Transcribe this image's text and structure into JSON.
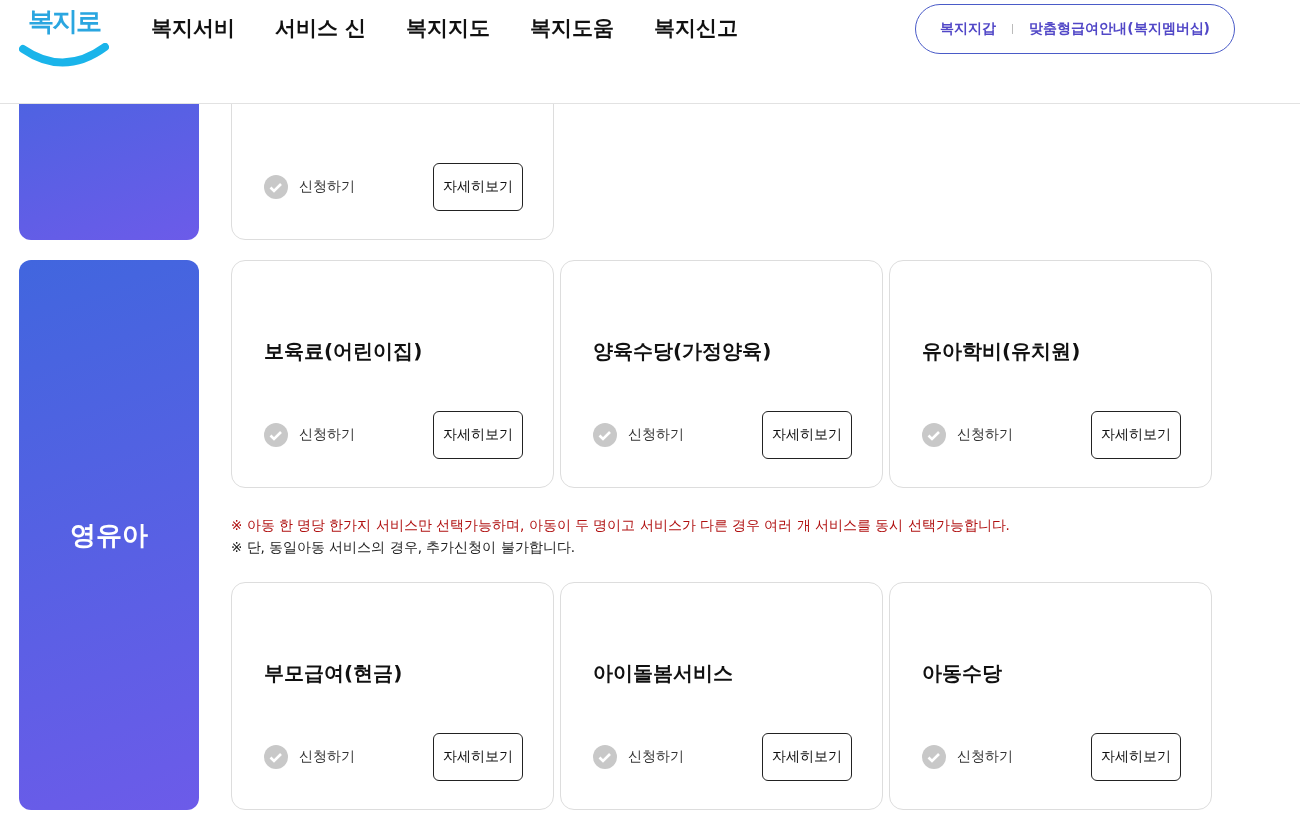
{
  "header": {
    "logo": "복지로",
    "nav": [
      "복지서비",
      "서비스 신",
      "복지지도",
      "복지도움",
      "복지신고"
    ],
    "quick_links": [
      "복지지갑",
      "맞춤형급여안내(복지멤버십)"
    ]
  },
  "partial_section": {
    "cards": [
      {
        "apply_label": "신청하기",
        "checked": false,
        "detail_button": "자세히보기"
      }
    ]
  },
  "section": {
    "category": "영유아",
    "card_rows": [
      [
        {
          "title": "보육료(어린이집)",
          "apply_label": "신청하기",
          "checked": false,
          "detail_button": "자세히보기"
        },
        {
          "title": "양육수당(가정양육)",
          "apply_label": "신청하기",
          "checked": false,
          "detail_button": "자세히보기"
        },
        {
          "title": "유아학비(유치원)",
          "apply_label": "신청하기",
          "checked": false,
          "detail_button": "자세히보기"
        }
      ],
      [
        {
          "title": "부모급여(현금)",
          "apply_label": "신청하기",
          "checked": false,
          "detail_button": "자세히보기"
        },
        {
          "title": "아이돌봄서비스",
          "apply_label": "신청하기",
          "checked": false,
          "detail_button": "자세히보기"
        },
        {
          "title": "아동수당",
          "apply_label": "신청하기",
          "checked": false,
          "detail_button": "자세히보기"
        }
      ]
    ],
    "notes": [
      {
        "text": "※ 아동 한 명당 한가지 서비스만 선택가능하며, 아동이 두 명이고 서비스가 다른 경우 여러 개 서비스를 동시 선택가능합니다.",
        "kind": "warning"
      },
      {
        "text": "※ 단, 동일아동 서비스의 경우, 추가신청이 불가합니다.",
        "kind": "plain"
      }
    ]
  }
}
